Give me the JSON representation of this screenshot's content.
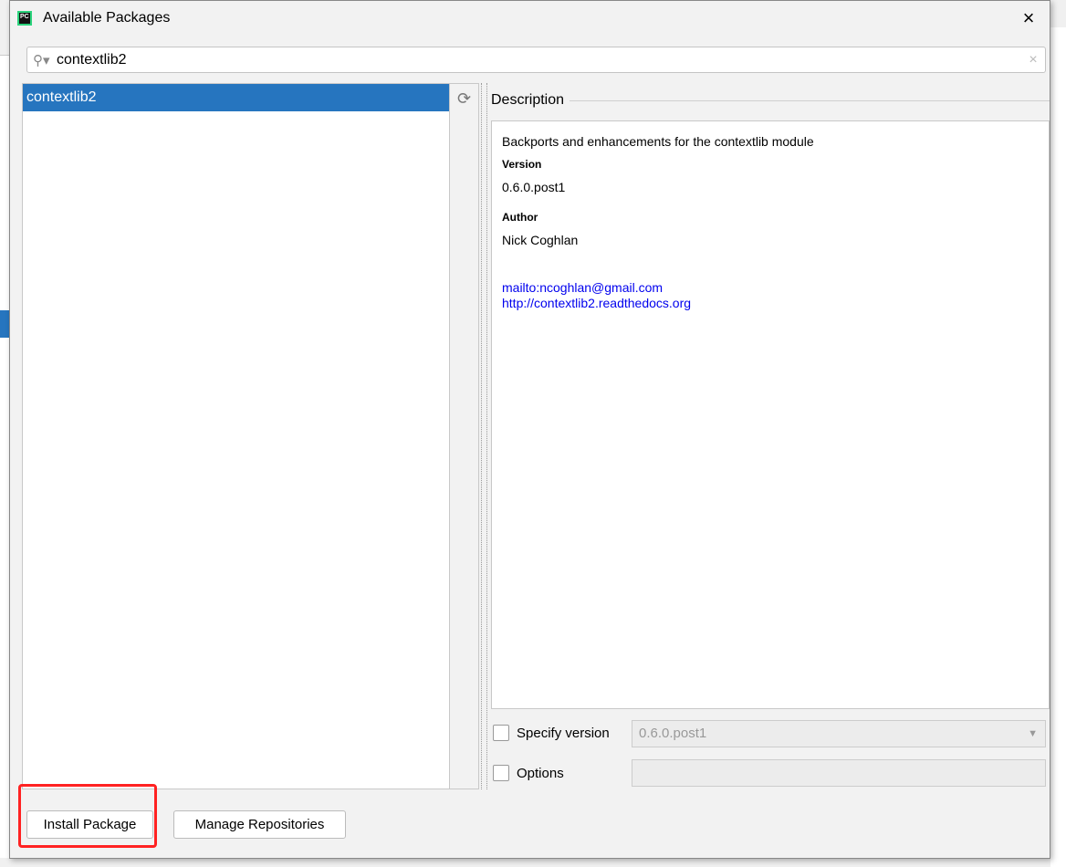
{
  "dialog": {
    "title": "Available Packages",
    "app_icon": "pycharm-icon",
    "close": "×"
  },
  "search": {
    "value": "contextlib2",
    "icon": "search-icon",
    "clear": "×"
  },
  "packages": [
    {
      "name": "contextlib2",
      "selected": true
    }
  ],
  "description": {
    "label": "Description",
    "summary": "Backports and enhancements for the contextlib module",
    "version_label": "Version",
    "version": "0.6.0.post1",
    "author_label": "Author",
    "author": "Nick Coghlan",
    "links": [
      "mailto:ncoghlan@gmail.com",
      "http://contextlib2.readthedocs.org"
    ]
  },
  "specify_version": {
    "label": "Specify version",
    "checked": false,
    "value": "0.6.0.post1"
  },
  "options": {
    "label": "Options",
    "checked": false,
    "value": ""
  },
  "buttons": {
    "install": "Install Package",
    "manage": "Manage Repositories"
  },
  "colors": {
    "selection": "#2675bf",
    "highlight": "#ff2222",
    "link": "#0000ee"
  }
}
